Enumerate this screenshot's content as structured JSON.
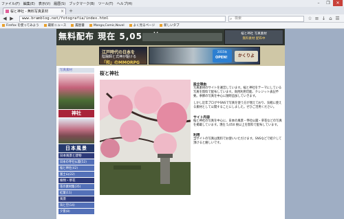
{
  "menubar": {
    "items": [
      "ファイル(F)",
      "編集(E)",
      "表示(V)",
      "履歴(S)",
      "ブックマーク(B)",
      "ツール(T)",
      "ヘルプ(H)"
    ],
    "window_controls": [
      "–",
      "❐",
      "✕"
    ]
  },
  "tab": {
    "label": "桜と神社 - 無料写真素材",
    "close": "×",
    "new_tab": "+"
  },
  "navbar": {
    "url": "www.bramblog.net/fotografia/index.html",
    "search_placeholder": "検索"
  },
  "bookmarks": [
    "Firefox を使ってみよう",
    "最新ニュース",
    "履歴書",
    "Manga,Comic,Novel",
    "よく見るページ",
    "新しいタブ"
  ],
  "header": {
    "logo_text": "無料配布 現在 5,050 枚",
    "right_banner_line1": "桜と神社 写真素材",
    "right_banner_line2": "無料素材 配布中"
  },
  "ads": {
    "ad1_line1": "江戸時代の日本を",
    "ad1_line2": "陰陽師と式神が駆ける",
    "ad1_line3": "「和」のMMORPG",
    "ad2_badge": "2015年",
    "ad2_open": "OPEN!",
    "ad2_brand": "かくりよ"
  },
  "sidebar": {
    "heading": "写真素材",
    "banner1": "神社",
    "banner2": "日本風景",
    "sections": [
      {
        "title": "日本風景と建物",
        "items": [
          "日本の寺社仏閣(52)",
          "桜と神社(42)",
          "富士山(22)"
        ]
      },
      {
        "title": "植物・草花",
        "items": [
          "花の素材集(35)",
          "紅葉(11)"
        ]
      },
      {
        "title": "風景",
        "items": [
          "海と空(14)",
          "夕景(8)"
        ]
      }
    ]
  },
  "main": {
    "title": "桜と神社",
    "text_blocks": [
      {
        "heading": "設立理由",
        "body": "写真素材のサイトを運営しています。桜と神社をテーマにしている写真を無料で配布しています。商用利用可能、クレジット表記不要。季節の写真を中心に随時追加していきます。"
      },
      {
        "heading": "",
        "body": "しかし近年ブログやSNSで写真を使う方が増えており、気軽に使える素材として公開することにしました。ぜひご活用ください。"
      },
      {
        "heading": "サイト内容",
        "body": "桜と神社の写真を中心に、日本の風景・寺社仏閣・草花などの写真を掲載しています。現在 5,050 枚以上を無料で配布しています。"
      },
      {
        "heading": "利用",
        "body": "当サイトの写真は無料でお使いいただけます。SNSなどで紹介して頂けると嬉しいです。"
      }
    ],
    "link_text": "5,050"
  },
  "colors": {
    "header_bg": "#333a33",
    "sidebar_section": "#2d3a7a",
    "sidebar_item": "#5370b8",
    "shrine_banner": "#a8243a"
  }
}
